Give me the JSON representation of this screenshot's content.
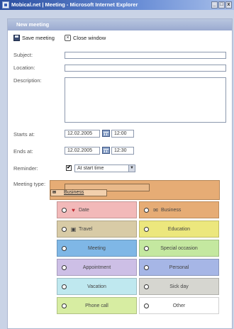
{
  "window": {
    "title": "Mobical.net | Meeting - Microsoft Internet Explorer",
    "buttons": [
      "_",
      "□",
      "x"
    ]
  },
  "panel": {
    "header": "New meeting"
  },
  "toolbar": {
    "save_label": "Save meeting",
    "save_icon": "save-icon",
    "close_label": "Close window",
    "close_icon": "close-icon"
  },
  "form": {
    "subject_label": "Subject:",
    "subject_value": "",
    "location_label": "Location:",
    "location_value": "",
    "description_label": "Description:",
    "description_value": "",
    "starts_label": "Starts at:",
    "starts_date": "12.02.2005",
    "starts_time": "12:00",
    "ends_label": "Ends at:",
    "ends_date": "12.02.2005",
    "ends_time": "12:30",
    "reminder_label": "Reminder:",
    "reminder_checked": "✔",
    "reminder_value": "At start time",
    "meeting_type_label": "Meeting type:",
    "meeting_type_selected": "Business"
  },
  "meeting_types": [
    {
      "label": "Date",
      "color": "#f2b9b9",
      "icon": "heart-icon",
      "glyph": "♥",
      "selected": false
    },
    {
      "label": "Business",
      "color": "#e6ac75",
      "icon": "business-icon",
      "glyph": "✉",
      "selected": false
    },
    {
      "label": "Travel",
      "color": "#d8cba6",
      "icon": "camera-icon",
      "glyph": "▣",
      "selected": false
    },
    {
      "label": "Education",
      "color": "#ece77d",
      "icon": "",
      "glyph": "",
      "selected": false
    },
    {
      "label": "Meeting",
      "color": "#7fb7e6",
      "icon": "",
      "glyph": "",
      "selected": false
    },
    {
      "label": "Special occasion",
      "color": "#c4e8a0",
      "icon": "",
      "glyph": "",
      "selected": false
    },
    {
      "label": "Appointment",
      "color": "#cdbfe6",
      "icon": "",
      "glyph": "",
      "selected": false
    },
    {
      "label": "Personal",
      "color": "#a6b6e6",
      "icon": "",
      "glyph": "",
      "selected": false
    },
    {
      "label": "Vacation",
      "color": "#bfe8ef",
      "icon": "",
      "glyph": "",
      "selected": false
    },
    {
      "label": "Sick day",
      "color": "#d6d6d0",
      "icon": "",
      "glyph": "",
      "selected": false
    },
    {
      "label": "Phone call",
      "color": "#d7eda2",
      "icon": "",
      "glyph": "",
      "selected": false
    },
    {
      "label": "Other",
      "color": "#ffffff",
      "icon": "",
      "glyph": "",
      "selected": false
    }
  ]
}
